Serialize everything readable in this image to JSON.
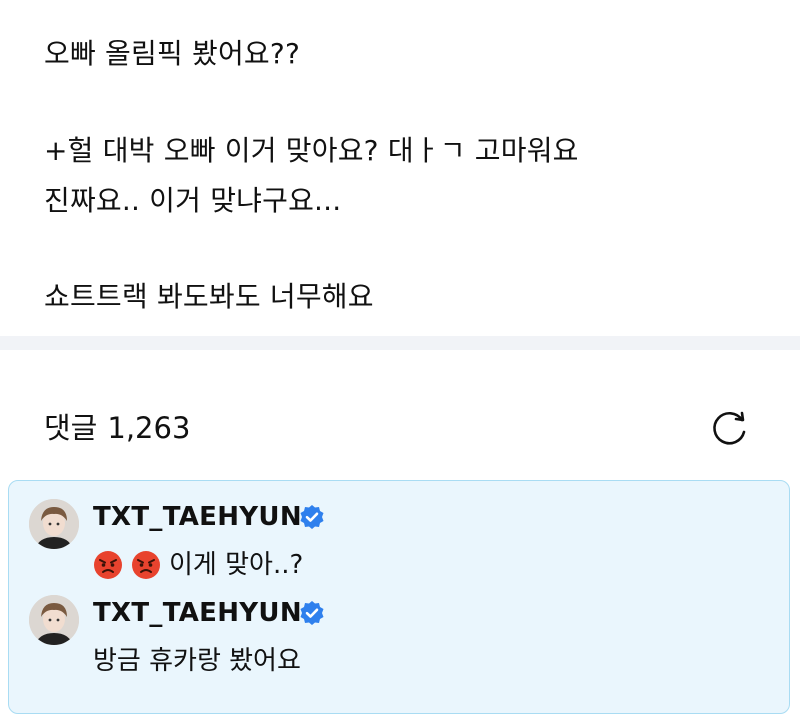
{
  "post": {
    "lines": [
      "오빠 올림픽 봤어요??",
      "+헐 대박 오빠 이거 맞아요? 대ㅏㄱ 고마워요",
      "진짜요.. 이거 맞냐구요...",
      "쇼트트랙 봐도봐도 너무해요"
    ]
  },
  "comments_section": {
    "title": "댓글",
    "count": "1,263",
    "refresh_icon": "refresh-icon"
  },
  "artist_comments": [
    {
      "author": "TXT_TAEHYUN",
      "verified": true,
      "text": "이게 맞아..?",
      "emojis": [
        "angry-face-icon",
        "angry-face-icon"
      ]
    },
    {
      "author": "TXT_TAEHYUN",
      "verified": true,
      "text": "방금 휴카랑 봤어요",
      "emojis": []
    }
  ],
  "colors": {
    "divider": "#f1f3f7",
    "artist_box_bg": "#eaf6fd",
    "artist_box_border": "#a9dcf3",
    "verified_badge": "#2f80ed",
    "emoji_red": "#e8432e"
  }
}
